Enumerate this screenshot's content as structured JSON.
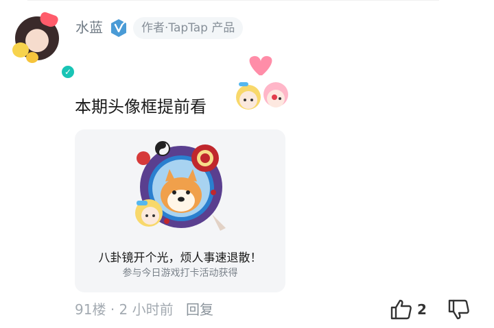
{
  "comment": {
    "user": {
      "name": "水蓝",
      "tag": "作者·TapTap 产品"
    },
    "text": "本期头像框提前看",
    "card": {
      "title": "八卦镜开个光，烦人事速退散！",
      "subtitle": "参与今日游戏打卡活动获得"
    },
    "meta": {
      "floor": "91楼",
      "separator": "·",
      "time": "2 小时前",
      "reply": "回复"
    },
    "likes": "2"
  },
  "icons": {
    "verified": "check-badge-icon",
    "creator": "v-shield-icon",
    "like": "thumbs-up-icon",
    "dislike": "thumbs-down-icon"
  },
  "colors": {
    "accent": "#19c4b5",
    "text_muted": "#a3aab1"
  }
}
